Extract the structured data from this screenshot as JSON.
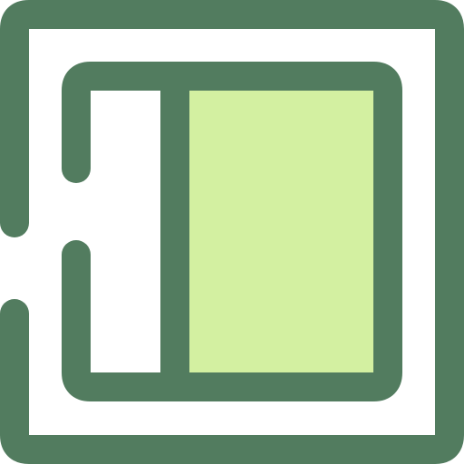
{
  "icon": {
    "name": "sidebar-layout-icon",
    "colors": {
      "stroke": "#527c5f",
      "panel_fill": "#d3f0a1",
      "background": "#ffffff"
    }
  }
}
